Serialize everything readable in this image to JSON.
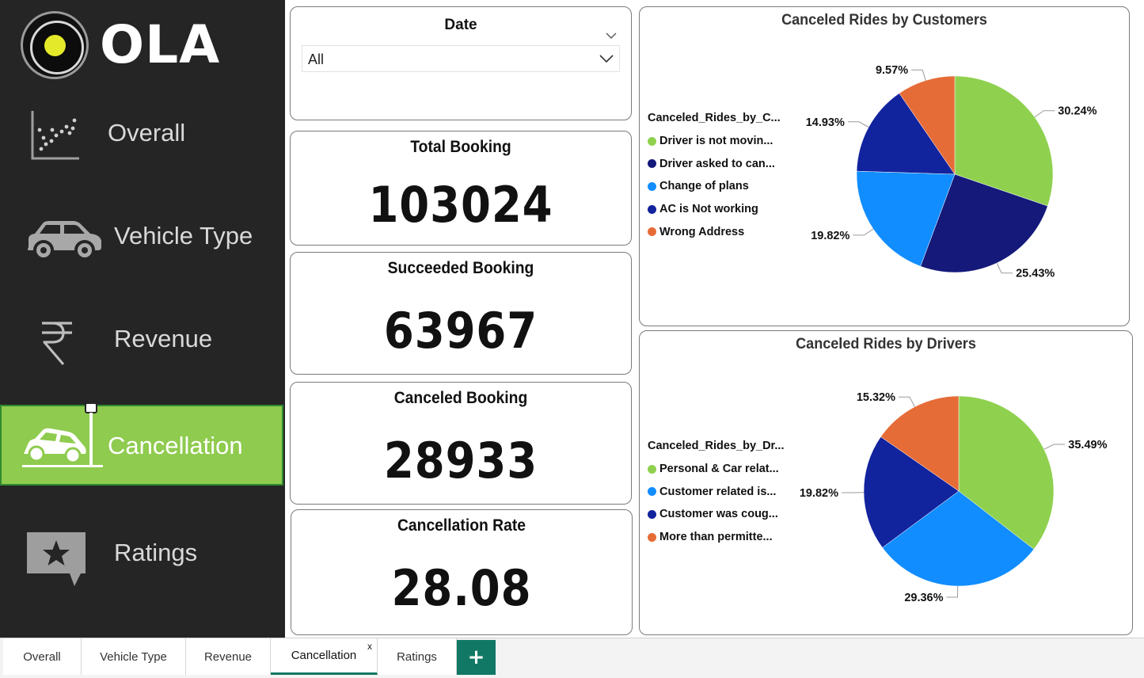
{
  "app": {
    "logo_text": "OLA"
  },
  "sidebar": {
    "items": [
      {
        "label": "Overall",
        "icon": "scatter-chart-icon",
        "active": false
      },
      {
        "label": "Vehicle Type",
        "icon": "car-icon",
        "active": false
      },
      {
        "label": "Revenue",
        "icon": "rupee-icon",
        "active": false
      },
      {
        "label": "Cancellation",
        "icon": "car-crash-icon",
        "active": true
      },
      {
        "label": "Ratings",
        "icon": "star-comment-icon",
        "active": false
      }
    ],
    "active_color": "#8fcb4e"
  },
  "slicer": {
    "title": "Date",
    "value": "All"
  },
  "kpis": [
    {
      "title": "Total Booking",
      "value": "103024"
    },
    {
      "title": "Succeeded Booking",
      "value": "63967"
    },
    {
      "title": "Canceled Booking",
      "value": "28933"
    },
    {
      "title": "Cancellation Rate",
      "value": "28.08"
    }
  ],
  "chart_data": [
    {
      "type": "pie",
      "title": "Canceled Rides by Customers",
      "legend_title": "Canceled_Rides_by_C...",
      "legend_position": "left",
      "slices": [
        {
          "label": "Driver is not movin...",
          "value": 30.24,
          "pct_label": "30.24%",
          "color": "#8fd14f"
        },
        {
          "label": "Driver asked to can...",
          "value": 25.43,
          "pct_label": "25.43%",
          "color": "#14197a"
        },
        {
          "label": "Change of plans",
          "value": 19.82,
          "pct_label": "19.82%",
          "color": "#118dff"
        },
        {
          "label": "AC is Not working",
          "value": 14.93,
          "pct_label": "14.93%",
          "color": "#12239e"
        },
        {
          "label": "Wrong Address",
          "value": 9.57,
          "pct_label": "9.57%",
          "color": "#e66c37"
        }
      ]
    },
    {
      "type": "pie",
      "title": "Canceled Rides by Drivers",
      "legend_title": "Canceled_Rides_by_Dr...",
      "legend_position": "left",
      "slices": [
        {
          "label": "Personal & Car relat...",
          "value": 35.49,
          "pct_label": "35.49%",
          "color": "#8fd14f"
        },
        {
          "label": "Customer related is...",
          "value": 29.36,
          "pct_label": "29.36%",
          "color": "#118dff"
        },
        {
          "label": "Customer was coug...",
          "value": 19.82,
          "pct_label": "19.82%",
          "color": "#12239e"
        },
        {
          "label": "More than permitte...",
          "value": 15.32,
          "pct_label": "15.32%",
          "color": "#e66c37"
        }
      ]
    }
  ],
  "tabs": [
    {
      "label": "Overall",
      "active": false
    },
    {
      "label": "Vehicle Type",
      "active": false
    },
    {
      "label": "Revenue",
      "active": false
    },
    {
      "label": "Cancellation",
      "active": true,
      "close": "x"
    },
    {
      "label": "Ratings",
      "active": false
    }
  ],
  "add_tab_label": "+"
}
